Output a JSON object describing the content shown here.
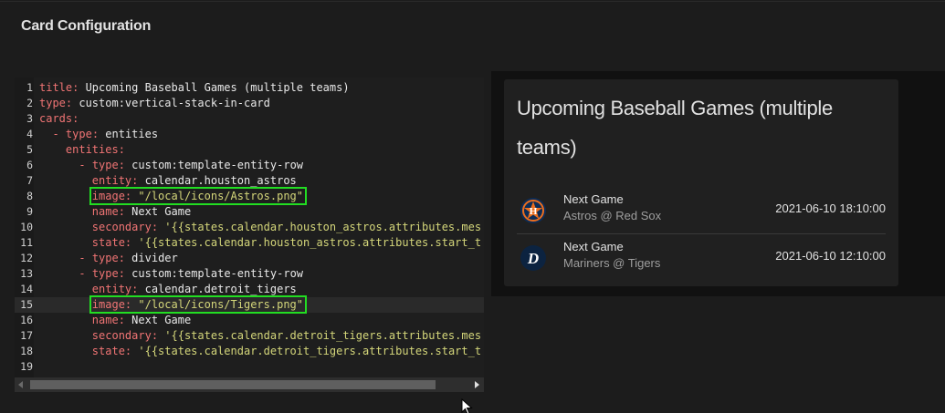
{
  "dialog": {
    "title": "Card Configuration"
  },
  "editor": {
    "lines": [
      {
        "num": "1",
        "key": "title",
        "value": " Upcoming Baseball Games (multiple teams)"
      },
      {
        "num": "2",
        "key": "type",
        "value": " custom:vertical-stack-in-card"
      },
      {
        "num": "3",
        "key": "cards",
        "value": ""
      },
      {
        "num": "4",
        "indent": "  - ",
        "key": "type",
        "value": " entities"
      },
      {
        "num": "5",
        "indent": "    ",
        "key": "entities",
        "value": ""
      },
      {
        "num": "6",
        "indent": "      - ",
        "key": "type",
        "value": " custom:template-entity-row"
      },
      {
        "num": "7",
        "indent": "        ",
        "key": "entity",
        "value": " calendar.houston_astros"
      },
      {
        "num": "8",
        "indent": "        ",
        "key": "image",
        "str": " \"/local/icons/Astros.png\""
      },
      {
        "num": "9",
        "indent": "        ",
        "key": "name",
        "value": " Next Game"
      },
      {
        "num": "10",
        "indent": "        ",
        "key": "secondary",
        "str": " '{{states.calendar.houston_astros.attributes.mes"
      },
      {
        "num": "11",
        "indent": "        ",
        "key": "state",
        "str": " '{{states.calendar.houston_astros.attributes.start_t"
      },
      {
        "num": "12",
        "indent": "      - ",
        "key": "type",
        "value": " divider"
      },
      {
        "num": "13",
        "indent": "      - ",
        "key": "type",
        "value": " custom:template-entity-row"
      },
      {
        "num": "14",
        "indent": "        ",
        "key": "entity",
        "value": " calendar.detroit_tigers"
      },
      {
        "num": "15",
        "indent": "        ",
        "key": "image",
        "str": " \"/local/icons/Tigers.png\""
      },
      {
        "num": "16",
        "indent": "        ",
        "key": "name",
        "value": " Next Game"
      },
      {
        "num": "17",
        "indent": "        ",
        "key": "secondary",
        "str": " '{{states.calendar.detroit_tigers.attributes.mes"
      },
      {
        "num": "18",
        "indent": "        ",
        "key": "state",
        "str": " '{{states.calendar.detroit_tigers.attributes.start_t"
      },
      {
        "num": "19",
        "indent": "",
        "key": "",
        "value": ""
      }
    ]
  },
  "preview": {
    "card_title": "Upcoming Baseball Games (multiple teams)",
    "rows": [
      {
        "name": "Next Game",
        "secondary": "Astros @ Red Sox",
        "state": "2021-06-10 18:10:00",
        "logo": "astros-logo-icon"
      },
      {
        "name": "Next Game",
        "secondary": "Mariners @ Tigers",
        "state": "2021-06-10 12:10:00",
        "logo": "tigers-logo-icon"
      }
    ]
  },
  "colors": {
    "yaml_key": "#f07474",
    "yaml_string": "#d4d67a",
    "highlight_box": "#22dd22",
    "background": "#1c1c1c"
  }
}
